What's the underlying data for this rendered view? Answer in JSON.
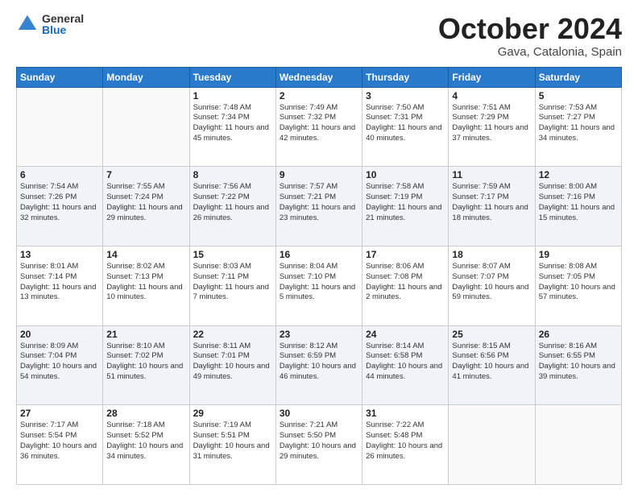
{
  "header": {
    "logo_general": "General",
    "logo_blue": "Blue",
    "month_title": "October 2024",
    "location": "Gava, Catalonia, Spain"
  },
  "weekdays": [
    "Sunday",
    "Monday",
    "Tuesday",
    "Wednesday",
    "Thursday",
    "Friday",
    "Saturday"
  ],
  "weeks": [
    [
      {
        "day": "",
        "detail": ""
      },
      {
        "day": "",
        "detail": ""
      },
      {
        "day": "1",
        "detail": "Sunrise: 7:48 AM\nSunset: 7:34 PM\nDaylight: 11 hours and 45 minutes."
      },
      {
        "day": "2",
        "detail": "Sunrise: 7:49 AM\nSunset: 7:32 PM\nDaylight: 11 hours and 42 minutes."
      },
      {
        "day": "3",
        "detail": "Sunrise: 7:50 AM\nSunset: 7:31 PM\nDaylight: 11 hours and 40 minutes."
      },
      {
        "day": "4",
        "detail": "Sunrise: 7:51 AM\nSunset: 7:29 PM\nDaylight: 11 hours and 37 minutes."
      },
      {
        "day": "5",
        "detail": "Sunrise: 7:53 AM\nSunset: 7:27 PM\nDaylight: 11 hours and 34 minutes."
      }
    ],
    [
      {
        "day": "6",
        "detail": "Sunrise: 7:54 AM\nSunset: 7:26 PM\nDaylight: 11 hours and 32 minutes."
      },
      {
        "day": "7",
        "detail": "Sunrise: 7:55 AM\nSunset: 7:24 PM\nDaylight: 11 hours and 29 minutes."
      },
      {
        "day": "8",
        "detail": "Sunrise: 7:56 AM\nSunset: 7:22 PM\nDaylight: 11 hours and 26 minutes."
      },
      {
        "day": "9",
        "detail": "Sunrise: 7:57 AM\nSunset: 7:21 PM\nDaylight: 11 hours and 23 minutes."
      },
      {
        "day": "10",
        "detail": "Sunrise: 7:58 AM\nSunset: 7:19 PM\nDaylight: 11 hours and 21 minutes."
      },
      {
        "day": "11",
        "detail": "Sunrise: 7:59 AM\nSunset: 7:17 PM\nDaylight: 11 hours and 18 minutes."
      },
      {
        "day": "12",
        "detail": "Sunrise: 8:00 AM\nSunset: 7:16 PM\nDaylight: 11 hours and 15 minutes."
      }
    ],
    [
      {
        "day": "13",
        "detail": "Sunrise: 8:01 AM\nSunset: 7:14 PM\nDaylight: 11 hours and 13 minutes."
      },
      {
        "day": "14",
        "detail": "Sunrise: 8:02 AM\nSunset: 7:13 PM\nDaylight: 11 hours and 10 minutes."
      },
      {
        "day": "15",
        "detail": "Sunrise: 8:03 AM\nSunset: 7:11 PM\nDaylight: 11 hours and 7 minutes."
      },
      {
        "day": "16",
        "detail": "Sunrise: 8:04 AM\nSunset: 7:10 PM\nDaylight: 11 hours and 5 minutes."
      },
      {
        "day": "17",
        "detail": "Sunrise: 8:06 AM\nSunset: 7:08 PM\nDaylight: 11 hours and 2 minutes."
      },
      {
        "day": "18",
        "detail": "Sunrise: 8:07 AM\nSunset: 7:07 PM\nDaylight: 10 hours and 59 minutes."
      },
      {
        "day": "19",
        "detail": "Sunrise: 8:08 AM\nSunset: 7:05 PM\nDaylight: 10 hours and 57 minutes."
      }
    ],
    [
      {
        "day": "20",
        "detail": "Sunrise: 8:09 AM\nSunset: 7:04 PM\nDaylight: 10 hours and 54 minutes."
      },
      {
        "day": "21",
        "detail": "Sunrise: 8:10 AM\nSunset: 7:02 PM\nDaylight: 10 hours and 51 minutes."
      },
      {
        "day": "22",
        "detail": "Sunrise: 8:11 AM\nSunset: 7:01 PM\nDaylight: 10 hours and 49 minutes."
      },
      {
        "day": "23",
        "detail": "Sunrise: 8:12 AM\nSunset: 6:59 PM\nDaylight: 10 hours and 46 minutes."
      },
      {
        "day": "24",
        "detail": "Sunrise: 8:14 AM\nSunset: 6:58 PM\nDaylight: 10 hours and 44 minutes."
      },
      {
        "day": "25",
        "detail": "Sunrise: 8:15 AM\nSunset: 6:56 PM\nDaylight: 10 hours and 41 minutes."
      },
      {
        "day": "26",
        "detail": "Sunrise: 8:16 AM\nSunset: 6:55 PM\nDaylight: 10 hours and 39 minutes."
      }
    ],
    [
      {
        "day": "27",
        "detail": "Sunrise: 7:17 AM\nSunset: 5:54 PM\nDaylight: 10 hours and 36 minutes."
      },
      {
        "day": "28",
        "detail": "Sunrise: 7:18 AM\nSunset: 5:52 PM\nDaylight: 10 hours and 34 minutes."
      },
      {
        "day": "29",
        "detail": "Sunrise: 7:19 AM\nSunset: 5:51 PM\nDaylight: 10 hours and 31 minutes."
      },
      {
        "day": "30",
        "detail": "Sunrise: 7:21 AM\nSunset: 5:50 PM\nDaylight: 10 hours and 29 minutes."
      },
      {
        "day": "31",
        "detail": "Sunrise: 7:22 AM\nSunset: 5:48 PM\nDaylight: 10 hours and 26 minutes."
      },
      {
        "day": "",
        "detail": ""
      },
      {
        "day": "",
        "detail": ""
      }
    ]
  ]
}
